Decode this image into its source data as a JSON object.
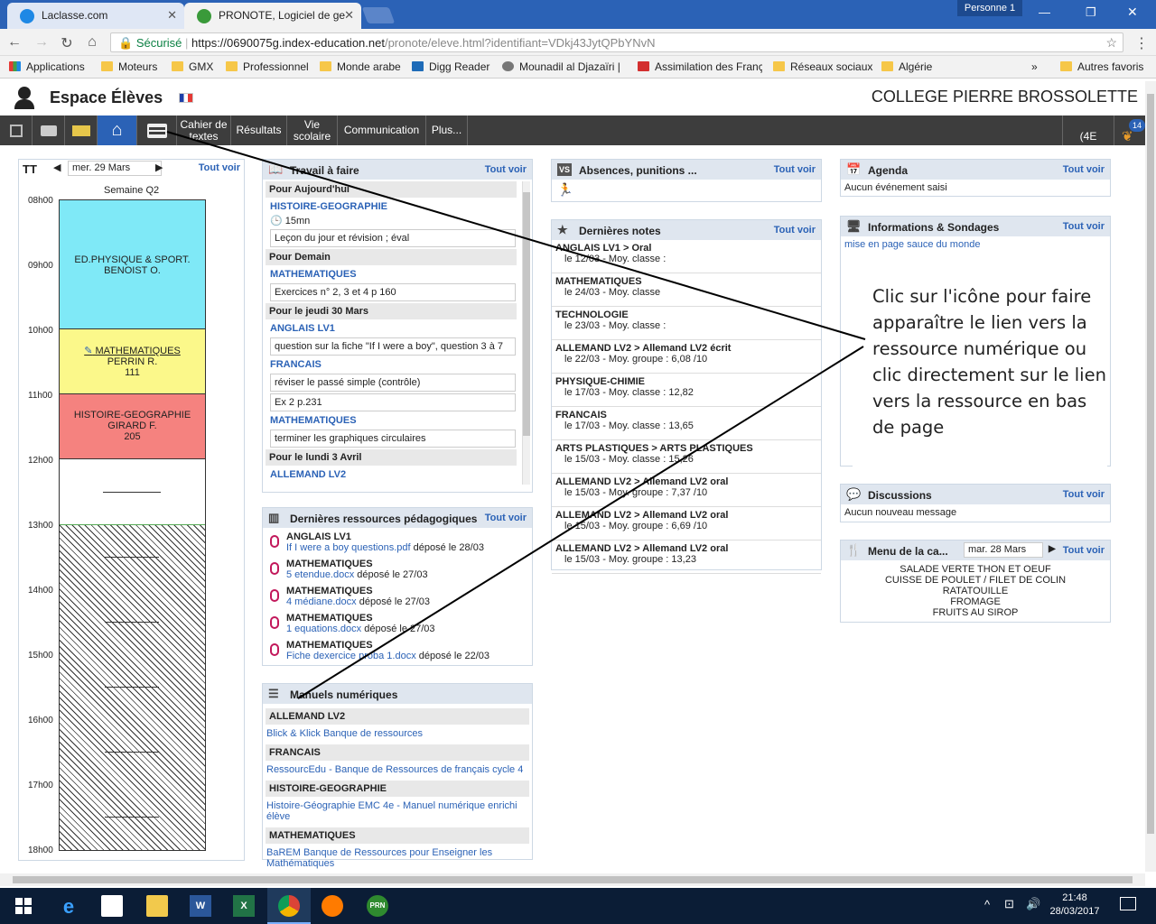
{
  "browser": {
    "tabs": [
      {
        "label": "Laclasse.com",
        "active": false
      },
      {
        "label": "PRONOTE, Logiciel de ge",
        "active": true
      }
    ],
    "profile": "Personne 1",
    "secure_label": "Sécurisé",
    "url_host": "https://0690075g.index-education.net",
    "url_path": "/pronote/eleve.html?identifiant=VDkj43JytQPbYNvN",
    "bookmarks": [
      "Applications",
      "Moteurs",
      "GMX",
      "Professionnel",
      "Monde arabe",
      "Digg Reader",
      "Mounadil al Djazaïri |",
      "Assimilation des Franç",
      "Réseaux sociaux",
      "Algérie",
      "Autres favoris"
    ]
  },
  "app": {
    "title": "Espace Élèves",
    "school": "COLLEGE PIERRE BROSSOLETTE",
    "class_label": "(4E",
    "badge_count": "14",
    "menu": [
      "Cahier de textes",
      "Résultats",
      "Vie scolaire",
      "Communication",
      "Plus..."
    ]
  },
  "schedule": {
    "date": "mer. 29 Mars",
    "see_all": "Tout voir",
    "week": "Semaine Q2",
    "hours": [
      "08h00",
      "09h00",
      "10h00",
      "11h00",
      "12h00",
      "13h00",
      "14h00",
      "15h00",
      "16h00",
      "17h00",
      "18h00"
    ],
    "courses": [
      {
        "subject": "ED.PHYSIQUE & SPORT.",
        "teacher": "BENOIST O.",
        "room": ""
      },
      {
        "subject": "MATHEMATIQUES",
        "teacher": "PERRIN R.",
        "room": "111"
      },
      {
        "subject": "HISTOIRE-GEOGRAPHIE",
        "teacher": "GIRARD F.",
        "room": "205"
      }
    ],
    "colors": {
      "sport": "#7fe9f7",
      "maths": "#fbf88a",
      "histgeo": "#f5827f"
    }
  },
  "travail": {
    "title": "Travail à faire",
    "see_all": "Tout voir",
    "today": "Pour Aujourd'hui",
    "today_subject": "HISTOIRE-GEOGRAPHIE",
    "today_duration": "15mn",
    "today_task": "Leçon du jour et révision ; éval",
    "tomorrow": "Pour Demain",
    "tomorrow_subject": "MATHEMATIQUES",
    "tomorrow_task": "Exercices n° 2, 3 et 4 p 160",
    "jeudi": "Pour le jeudi 30 Mars",
    "jeudi_s1": "ANGLAIS LV1",
    "jeudi_t1": "question sur la fiche \"If I were a boy\", question 3 à 7",
    "jeudi_s2": "FRANCAIS",
    "jeudi_t2": "réviser le passé simple (contrôle)",
    "jeudi_t3": "Ex 2 p.231",
    "jeudi_s3": "MATHEMATIQUES",
    "jeudi_t4": "terminer les graphiques circulaires",
    "lundi": "Pour le lundi 3 Avril",
    "lundi_s1": "ALLEMAND LV2"
  },
  "ressources": {
    "title": "Dernières ressources pédagogiques",
    "see_all": "Tout voir",
    "items": [
      {
        "subject": "ANGLAIS LV1",
        "file": "If I were a boy questions.pdf",
        "date": "déposé le 28/03"
      },
      {
        "subject": "MATHEMATIQUES",
        "file": "5 etendue.docx",
        "date": "déposé le 27/03"
      },
      {
        "subject": "MATHEMATIQUES",
        "file": "4 médiane.docx",
        "date": "déposé le 27/03"
      },
      {
        "subject": "MATHEMATIQUES",
        "file": "1 equations.docx",
        "date": "déposé le 27/03"
      },
      {
        "subject": "MATHEMATIQUES",
        "file": "Fiche dexercice proba 1.docx",
        "date": "déposé le 22/03"
      }
    ]
  },
  "manuels": {
    "title": "Manuels numériques",
    "items": [
      {
        "subject": "ALLEMAND LV2",
        "link": "Blick & Klick Banque de ressources"
      },
      {
        "subject": "FRANCAIS",
        "link": "RessourcEdu - Banque de Ressources de français cycle 4"
      },
      {
        "subject": "HISTOIRE-GEOGRAPHIE",
        "link": "Histoire-Géographie EMC 4e - Manuel numérique enrichi élève"
      },
      {
        "subject": "MATHEMATIQUES",
        "link": "BaREM Banque de Ressources pour Enseigner les Mathématiques"
      }
    ]
  },
  "absences": {
    "title": "Absences, punitions ...",
    "see_all": "Tout voir",
    "icon_label": "VS"
  },
  "notes": {
    "title": "Dernières notes",
    "see_all": "Tout voir",
    "items": [
      {
        "subject": "ANGLAIS LV1 > Oral",
        "detail": "le 12/03 - Moy. classe :"
      },
      {
        "subject": "MATHEMATIQUES",
        "detail": "le 24/03 - Moy. classe"
      },
      {
        "subject": "TECHNOLOGIE",
        "detail": "le 23/03 - Moy. classe :"
      },
      {
        "subject": "ALLEMAND LV2 > Allemand LV2 écrit",
        "detail": "le 22/03 - Moy. groupe : 6,08 /10"
      },
      {
        "subject": "PHYSIQUE-CHIMIE",
        "detail": "le 17/03 - Moy. classe : 12,82"
      },
      {
        "subject": "FRANCAIS",
        "detail": "le 17/03 - Moy. classe : 13,65"
      },
      {
        "subject": "ARTS PLASTIQUES > ARTS PLASTIQUES",
        "detail": "le 15/03 - Moy. classe : 15,26"
      },
      {
        "subject": "ALLEMAND LV2 > Allemand LV2 oral",
        "detail": "le 15/03 - Moy. groupe : 7,37 /10"
      },
      {
        "subject": "ALLEMAND LV2 > Allemand LV2 oral",
        "detail": "le 15/03 - Moy. groupe : 6,69 /10"
      },
      {
        "subject": "ALLEMAND LV2 > Allemand LV2 oral",
        "detail": "le 15/03 - Moy. groupe : 13,23"
      }
    ]
  },
  "agenda": {
    "title": "Agenda",
    "see_all": "Tout voir",
    "empty": "Aucun événement saisi"
  },
  "infos": {
    "title": "Informations & Sondages",
    "see_all": "Tout voir",
    "item": "mise en page sauce du monde"
  },
  "discussions": {
    "title": "Discussions",
    "see_all": "Tout voir",
    "empty": "Aucun nouveau message"
  },
  "menu_cantine": {
    "title": "Menu de la ca...",
    "date": "mar. 28 Mars",
    "see_all": "Tout voir",
    "lines": [
      "SALADE VERTE THON ET OEUF",
      "CUISSE DE POULET / FILET DE COLIN",
      "RATATOUILLE",
      "FROMAGE",
      "FRUITS AU SIROP"
    ]
  },
  "annotation": "Clic sur l'icône pour faire apparaître le lien vers la ressource numérique ou clic directement sur le lien vers la ressource en bas de page",
  "taskbar": {
    "time": "21:48",
    "date": "28/03/2017"
  }
}
